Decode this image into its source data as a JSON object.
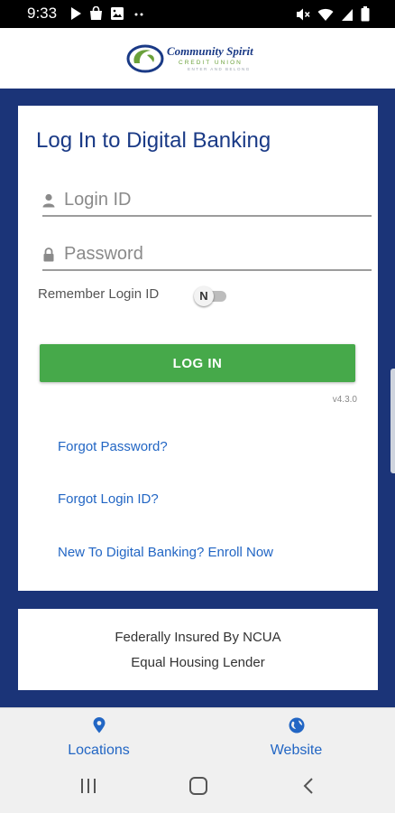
{
  "status_bar": {
    "time": "9:33",
    "left_icons": [
      "play-icon",
      "bag-icon",
      "image-icon",
      "more-dots-icon"
    ],
    "right_icons": [
      "mute-icon",
      "wifi-icon",
      "signal-icon",
      "battery-icon"
    ]
  },
  "header": {
    "logo_name": "Community Spirit",
    "logo_subtitle": "CREDIT UNION",
    "logo_tagline": "ENTER AND BELONG"
  },
  "login": {
    "title": "Log In to Digital Banking",
    "login_id_placeholder": "Login ID",
    "login_id_value": "",
    "password_placeholder": "Password",
    "password_value": "",
    "remember_label": "Remember Login ID",
    "remember_toggle": "N",
    "login_button": "LOG IN",
    "version": "v4.3.0",
    "links": [
      "Forgot Password?",
      "Forgot Login ID?",
      "New To Digital Banking? Enroll Now"
    ]
  },
  "info": {
    "line1": "Federally Insured By NCUA",
    "line2": "Equal Housing Lender"
  },
  "bottom_nav": {
    "locations": "Locations",
    "website": "Website"
  },
  "colors": {
    "brand_blue": "#1b3478",
    "title_blue": "#1a3a86",
    "link_blue": "#2266c4",
    "button_green": "#46a94a"
  }
}
